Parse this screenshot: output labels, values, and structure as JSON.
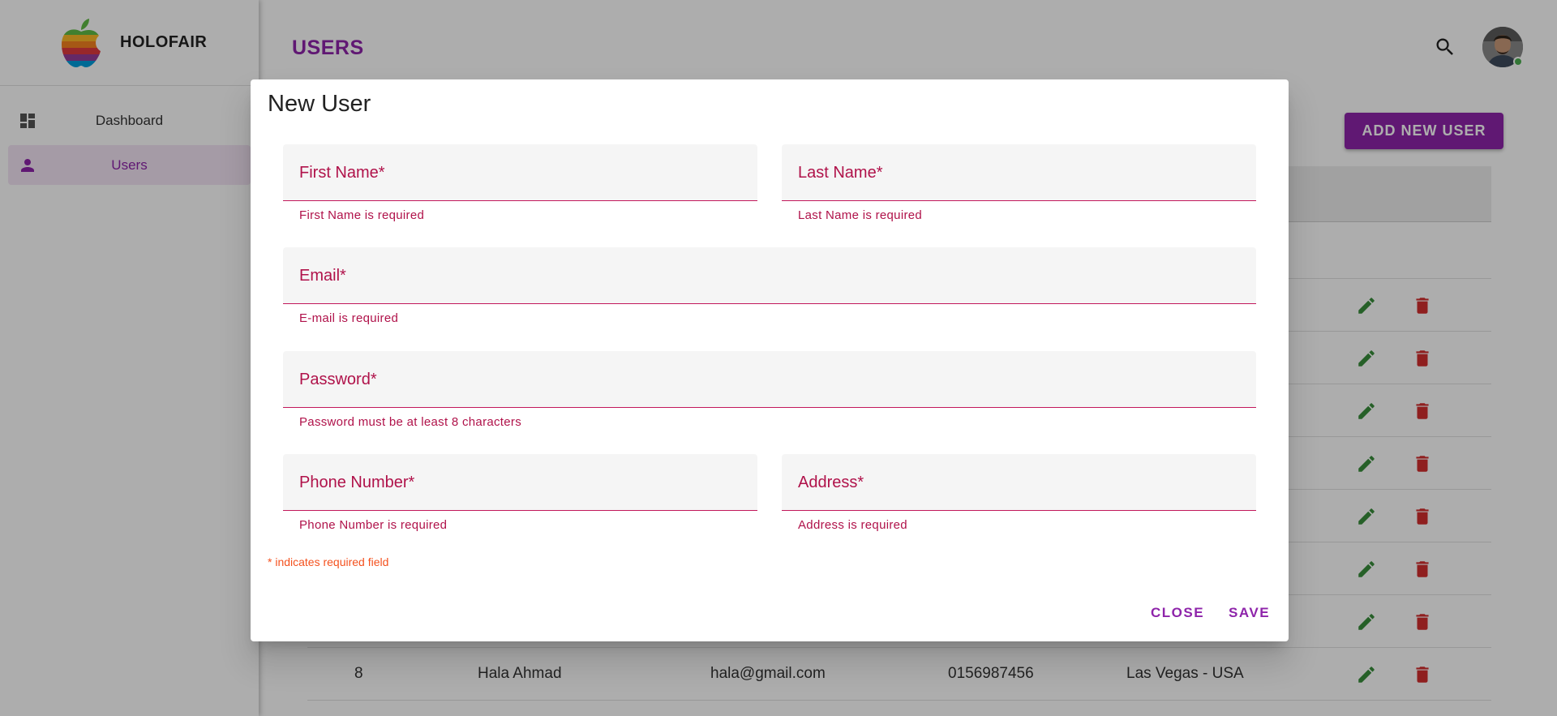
{
  "brand": {
    "name": "HOLOFAIR",
    "logo_icon": "rainbow-apple-logo"
  },
  "sidebar": {
    "items": [
      {
        "label": "Dashboard",
        "icon": "dashboard-icon",
        "active": false
      },
      {
        "label": "Users",
        "icon": "person-icon",
        "active": true
      }
    ]
  },
  "header": {
    "title": "USERS",
    "search_icon": "search-icon",
    "avatar_status": "online"
  },
  "main": {
    "add_button_label": "ADD NEW USER",
    "visible_row": {
      "id": "8",
      "name": "Hala Ahmad",
      "email": "hala@gmail.com",
      "phone": "0156987456",
      "address": "Las Vegas - USA"
    },
    "row_count_visible": 8
  },
  "dialog": {
    "title": "New User",
    "fields": {
      "first_name": {
        "label": "First Name",
        "value": "",
        "error": "First Name is required"
      },
      "last_name": {
        "label": "Last Name",
        "value": "",
        "error": "Last Name is required"
      },
      "email": {
        "label": "Email",
        "value": "",
        "error": "E-mail is required"
      },
      "password": {
        "label": "Password",
        "value": "",
        "error": "Password must be at least 8 characters"
      },
      "phone": {
        "label": "Phone Number",
        "value": "",
        "error": "Phone Number is required"
      },
      "address": {
        "label": "Address",
        "value": "",
        "error": "Address is required"
      }
    },
    "required_mark": "*",
    "required_note": "* indicates required field",
    "close_label": "CLOSE",
    "save_label": "SAVE"
  },
  "colors": {
    "accent": "#8e24aa",
    "error": "#b0124a",
    "edit": "#388e3c",
    "delete": "#d32f2f",
    "note": "#f4511e"
  }
}
